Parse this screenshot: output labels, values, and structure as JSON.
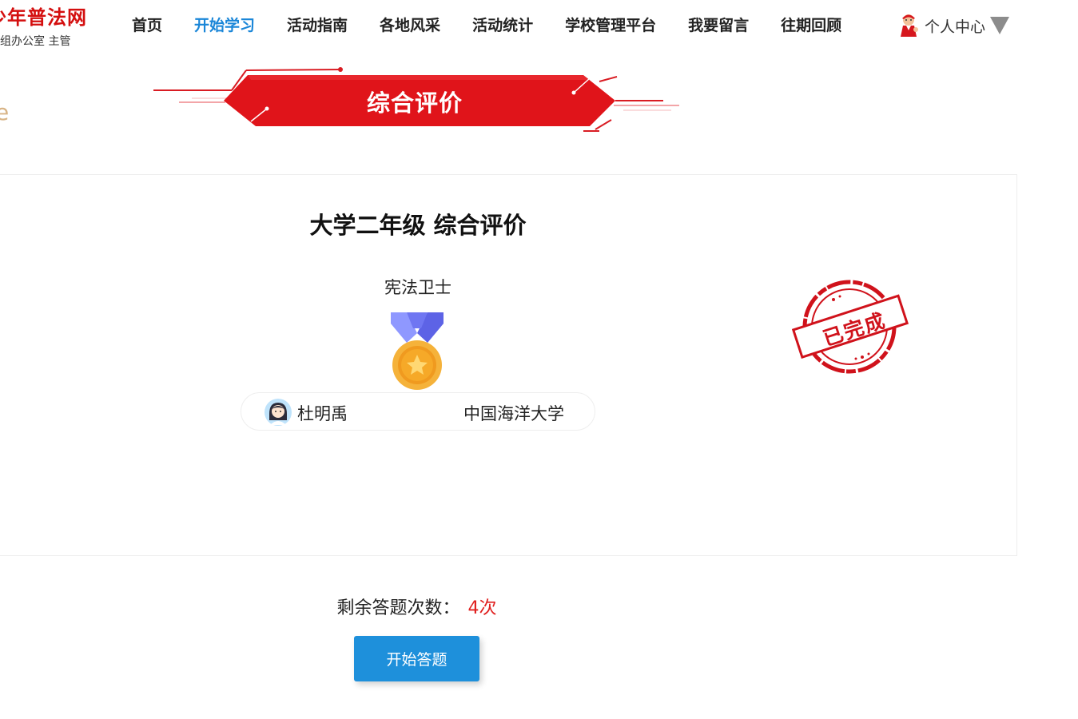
{
  "header": {
    "logo_title": "少年普法网",
    "logo_subtitle": "小组办公室 主管",
    "nav": [
      {
        "label": "首页",
        "active": false
      },
      {
        "label": "开始学习",
        "active": true
      },
      {
        "label": "活动指南",
        "active": false
      },
      {
        "label": "各地风采",
        "active": false
      },
      {
        "label": "活动统计",
        "active": false
      },
      {
        "label": "学校管理平台",
        "active": false
      },
      {
        "label": "我要留言",
        "active": false
      },
      {
        "label": "往期回顾",
        "active": false
      }
    ],
    "user_center": {
      "label": "个人中心",
      "icon": "mascot-avatar-icon",
      "dropdown_icon": "caret-down-icon"
    }
  },
  "left_fragment": "e",
  "banner": {
    "title": "综合评价"
  },
  "card": {
    "title": "大学二年级 综合评价",
    "badge_name": "宪法卫士",
    "medal_icon": "gold-medal-icon",
    "student": {
      "name": "杜明禹",
      "school": "中国海洋大学",
      "avatar_icon": "student-avatar-icon"
    },
    "stamp": {
      "text": "已完成"
    }
  },
  "footer": {
    "attempts_label": "剩余答题次数：",
    "attempts_value": "4次",
    "start_button": "开始答题"
  },
  "colors": {
    "brand_red": "#d40f0f",
    "nav_active": "#1a86d8",
    "button_blue": "#1e90db",
    "attempts_red": "#e0201f"
  }
}
